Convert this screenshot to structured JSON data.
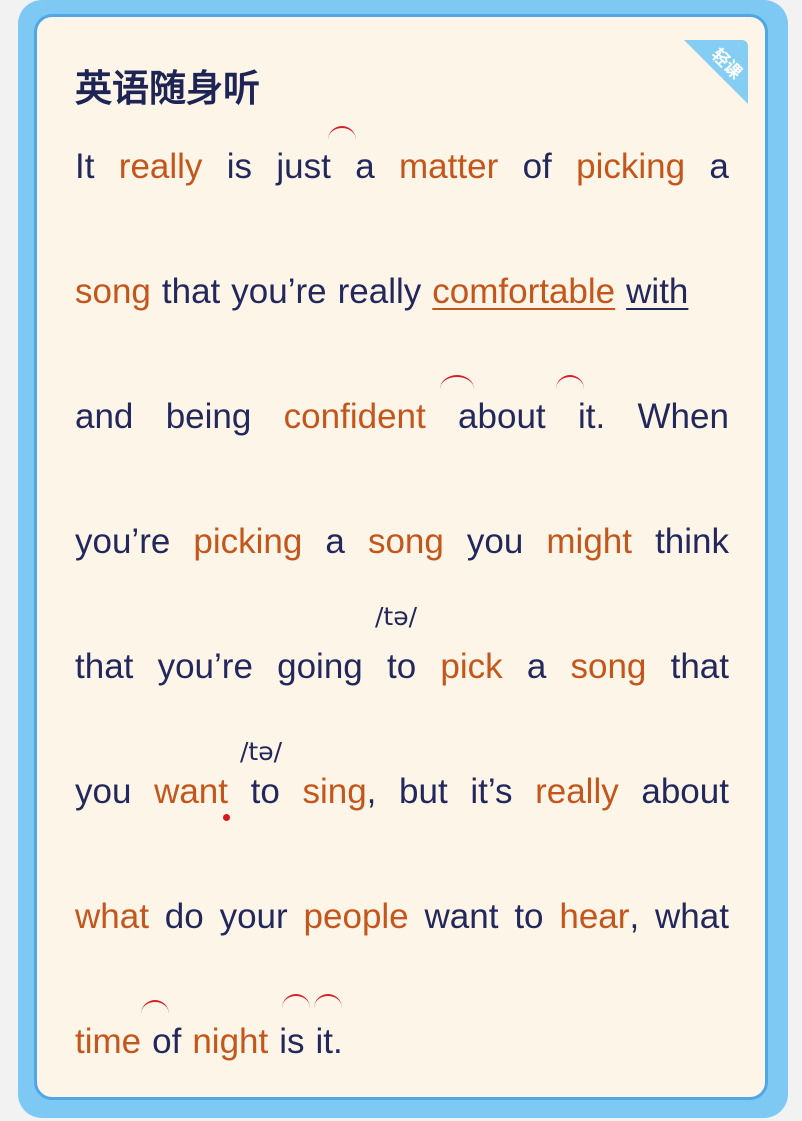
{
  "header": {
    "title": "英语随身听",
    "badge": "轻课"
  },
  "lines": [
    [
      "It",
      "really",
      "is",
      "just",
      "a",
      "matter",
      "of",
      "picking",
      "a"
    ],
    [
      "song",
      "that",
      "you’re",
      "really",
      "comfortable",
      "with"
    ],
    [
      "and",
      "being",
      "confident",
      "about",
      "it.",
      "When"
    ],
    [
      "you’re",
      "picking",
      "a",
      "song",
      "you",
      "might",
      "think"
    ],
    [
      "that",
      "you’re",
      "going",
      "to",
      "pick",
      "a",
      "song",
      "that"
    ],
    [
      "you",
      "want",
      "to",
      "sing",
      ",",
      "but",
      "it’s",
      "really",
      "about"
    ],
    [
      "what",
      "do",
      "your",
      "people",
      "want",
      "to",
      "hear",
      ",",
      "what"
    ],
    [
      "time",
      "of",
      "night",
      "is",
      "it."
    ]
  ],
  "pronunciation": {
    "ipa_1": "/tə/",
    "ipa_2": "/tə/"
  },
  "colors": {
    "text": "#23285c",
    "highlight": "#c4561c",
    "link_mark": "#d4202a",
    "frame": "#7ec8f4"
  }
}
